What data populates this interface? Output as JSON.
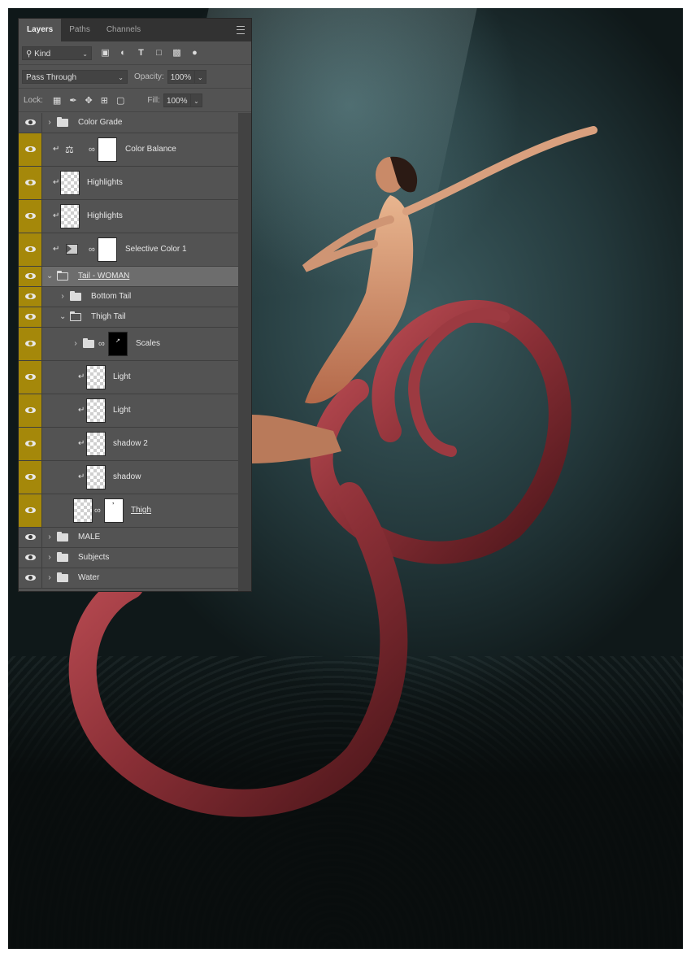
{
  "panel": {
    "tabs": [
      {
        "label": "Layers",
        "active": true
      },
      {
        "label": "Paths",
        "active": false
      },
      {
        "label": "Channels",
        "active": false
      }
    ],
    "filter": {
      "kind_label": "Kind",
      "icons": [
        "image-filter-icon",
        "adjustment-filter-icon",
        "type-filter-icon",
        "shape-filter-icon",
        "smart-object-filter-icon",
        "filter-toggle-icon"
      ]
    },
    "blend_mode": "Pass Through",
    "opacity_label": "Opacity:",
    "opacity_value": "100%",
    "lock_label": "Lock:",
    "fill_label": "Fill:",
    "fill_value": "100%"
  },
  "layers": [
    {
      "name": "Color Grade",
      "type": "group",
      "expanded": false,
      "visible": true,
      "highlighted": false
    },
    {
      "name": "Color Balance",
      "type": "adjustment",
      "clipped": true,
      "visible": true,
      "highlighted": true
    },
    {
      "name": "Highlights",
      "type": "pixel",
      "clipped": true,
      "visible": true,
      "highlighted": true
    },
    {
      "name": "Highlights",
      "type": "pixel",
      "clipped": true,
      "visible": true,
      "highlighted": true
    },
    {
      "name": "Selective Color 1",
      "type": "adjustment",
      "clipped": true,
      "visible": true,
      "highlighted": true
    },
    {
      "name": "Tail - WOMAN",
      "type": "group",
      "expanded": true,
      "visible": true,
      "highlighted": true,
      "selected": true
    },
    {
      "name": "Bottom Tail",
      "type": "group",
      "expanded": false,
      "visible": true,
      "highlighted": true
    },
    {
      "name": "Thigh Tail",
      "type": "group",
      "expanded": true,
      "visible": true,
      "highlighted": true
    },
    {
      "name": "Scales",
      "type": "group-masked",
      "expanded": false,
      "visible": true,
      "highlighted": true
    },
    {
      "name": "Light",
      "type": "pixel",
      "clipped": true,
      "visible": true,
      "highlighted": true
    },
    {
      "name": "Light",
      "type": "pixel",
      "clipped": true,
      "visible": true,
      "highlighted": true
    },
    {
      "name": "shadow 2",
      "type": "pixel",
      "clipped": true,
      "visible": true,
      "highlighted": true
    },
    {
      "name": "shadow",
      "type": "pixel",
      "clipped": true,
      "visible": true,
      "highlighted": true
    },
    {
      "name": "Thigh",
      "type": "smart-masked",
      "visible": true,
      "highlighted": true
    },
    {
      "name": "MALE",
      "type": "group",
      "expanded": false,
      "visible": true,
      "highlighted": false
    },
    {
      "name": "Subjects",
      "type": "group",
      "expanded": false,
      "visible": true,
      "highlighted": false
    },
    {
      "name": "Water",
      "type": "group",
      "expanded": false,
      "visible": true,
      "highlighted": false
    }
  ],
  "colors": {
    "visibility_highlight": "#a5880a",
    "panel_bg": "#535353",
    "tail": "#8a2f36"
  }
}
